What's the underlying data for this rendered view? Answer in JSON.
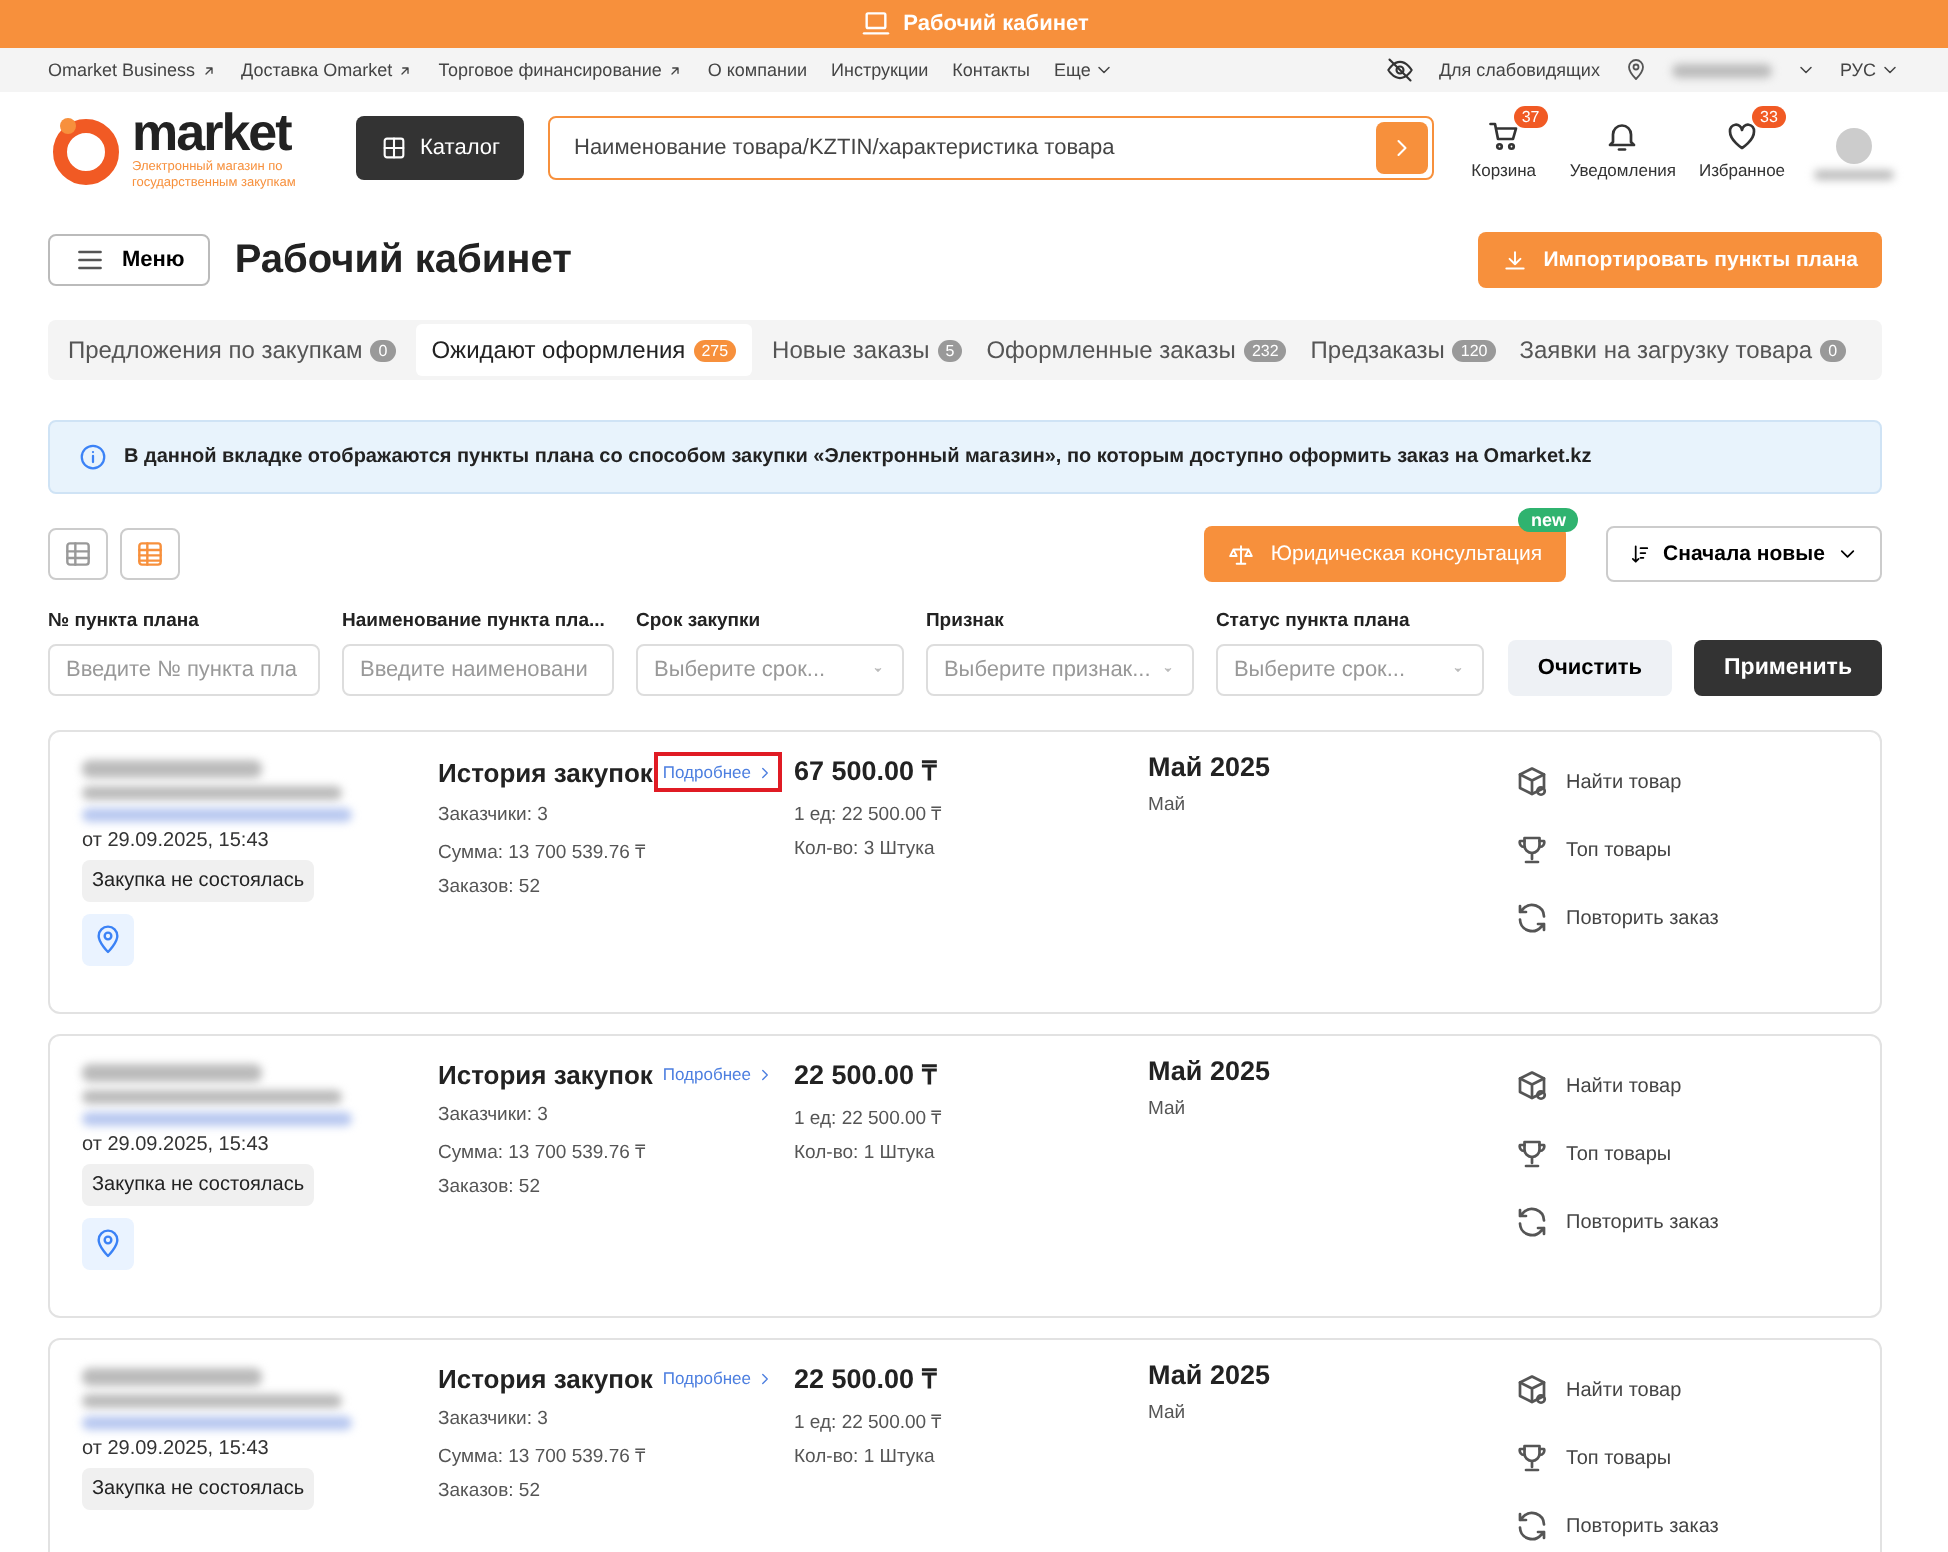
{
  "top_bar": {
    "title": "Рабочий кабинет"
  },
  "links": [
    {
      "label": "Omarket Business",
      "external": true
    },
    {
      "label": "Доставка Omarket",
      "external": true
    },
    {
      "label": "Торговое финансирование",
      "external": true
    },
    {
      "label": "О компании",
      "external": false
    },
    {
      "label": "Инструкции",
      "external": false
    },
    {
      "label": "Контакты",
      "external": false
    },
    {
      "label": "Еще",
      "external": false,
      "dropdown": true
    }
  ],
  "accessibility": "Для слабовидящих",
  "language": "РУС",
  "logo": {
    "name": "market",
    "tagline": "Электронный магазин по государственным закупкам"
  },
  "catalog_button": "Каталог",
  "search": {
    "placeholder": "Наименование товара/KZTIN/характеристика товара"
  },
  "header_icons": [
    {
      "kind": "cart",
      "label": "Корзина",
      "badge": "37"
    },
    {
      "kind": "bell",
      "label": "Уведомления"
    },
    {
      "kind": "heart",
      "label": "Избранное",
      "badge": "33"
    },
    {
      "kind": "user"
    }
  ],
  "menu_button": "Меню",
  "page_title": "Рабочий кабинет",
  "import_button": "Импортировать пункты плана",
  "tabs": [
    {
      "label": "Предложения по закупкам",
      "count": "0",
      "selected": false
    },
    {
      "label": "Ожидают оформления",
      "count": "275",
      "selected": true
    },
    {
      "label": "Новые заказы",
      "count": "5",
      "selected": false
    },
    {
      "label": "Оформленные заказы",
      "count": "232",
      "selected": false
    },
    {
      "label": "Предзаказы",
      "count": "120",
      "selected": false
    },
    {
      "label": "Заявки на загрузку товара",
      "count": "0",
      "selected": false
    }
  ],
  "info": "В данной вкладке отображаются пункты плана со способом закупки «Электронный магазин», по которым доступно оформить заказ на Omarket.kz",
  "view_toggles": [
    {
      "kind": "table",
      "selected": false
    },
    {
      "kind": "list",
      "selected": true
    }
  ],
  "legal_button": {
    "label": "Юридическая консультация",
    "badge": "new"
  },
  "sort": "Сначала новые",
  "filters": [
    {
      "label": "№ пункта плана",
      "placeholder": "Введите № пункта пла",
      "kind": "input"
    },
    {
      "label": "Наименование пункта пла...",
      "placeholder": "Введите наименовани",
      "kind": "input"
    },
    {
      "label": "Срок закупки",
      "placeholder": "Выберите срок...",
      "kind": "select"
    },
    {
      "label": "Признак",
      "placeholder": "Выберите признак...",
      "kind": "select"
    },
    {
      "label": "Статус пункта плана",
      "placeholder": "Выберите срок...",
      "kind": "select"
    }
  ],
  "clear_button": "Очистить",
  "apply_button": "Применить",
  "cards": [
    {
      "date": "от 29.09.2025, 15:43",
      "status": "Закупка не состоялась",
      "location": true,
      "history_title": "История закупок",
      "details_link": "Подробнее",
      "highlighted": true,
      "customers": "Заказчики: 3",
      "sum": "Сумма: 13 700 539.76 ₸",
      "orders": "Заказов: 52",
      "price": "67 500.00 ₸",
      "unit_price": "1 ед: 22 500.00 ₸",
      "quantity": "Кол-во: 3 Штука",
      "period": "Май 2025",
      "month": "Май",
      "actions": [
        {
          "kind": "find",
          "label": "Найти товар"
        },
        {
          "kind": "top",
          "label": "Топ товары"
        },
        {
          "kind": "repeat",
          "label": "Повторить заказ"
        }
      ]
    },
    {
      "date": "от 29.09.2025, 15:43",
      "status": "Закупка не состоялась",
      "location": true,
      "history_title": "История закупок",
      "details_link": "Подробнее",
      "highlighted": false,
      "customers": "Заказчики: 3",
      "sum": "Сумма: 13 700 539.76 ₸",
      "orders": "Заказов: 52",
      "price": "22 500.00 ₸",
      "unit_price": "1 ед: 22 500.00 ₸",
      "quantity": "Кол-во: 1 Штука",
      "period": "Май 2025",
      "month": "Май",
      "actions": [
        {
          "kind": "find",
          "label": "Найти товар"
        },
        {
          "kind": "top",
          "label": "Топ товары"
        },
        {
          "kind": "repeat",
          "label": "Повторить заказ"
        }
      ]
    },
    {
      "date": "от 29.09.2025, 15:43",
      "status": "Закупка не состоялась",
      "location": false,
      "history_title": "История закупок",
      "details_link": "Подробнее",
      "highlighted": false,
      "customers": "Заказчики: 3",
      "sum": "Сумма: 13 700 539.76 ₸",
      "orders": "Заказов: 52",
      "price": "22 500.00 ₸",
      "unit_price": "1 ед: 22 500.00 ₸",
      "quantity": "Кол-во: 1 Штука",
      "period": "Май 2025",
      "month": "Май",
      "actions": [
        {
          "kind": "find",
          "label": "Найти товар"
        },
        {
          "kind": "top",
          "label": "Топ товары"
        },
        {
          "kind": "repeat",
          "label": "Повторить заказ"
        }
      ]
    }
  ]
}
